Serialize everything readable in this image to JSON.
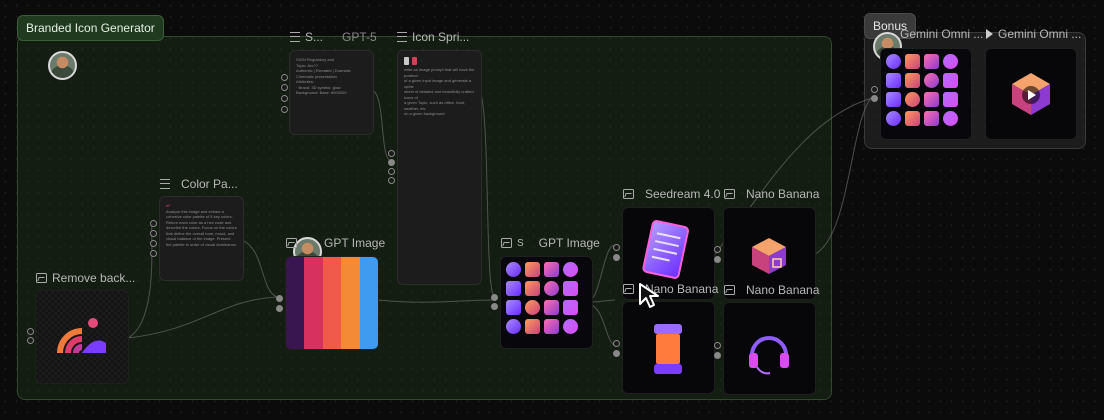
{
  "groups": {
    "main": {
      "title": "Branded Icon Generator"
    },
    "bonus": {
      "title": "Bonus"
    }
  },
  "nodes": {
    "system_prompt": {
      "title": "S...",
      "model": "GPT-5",
      "text": "SIGN Regulatory and\nTopic: Arc??\nAuthentic | Elevated | Dramatic Cinematic presentation\nAttributes:\n· Brand: 3D symbol: glow\nBackground: Base: #000000"
    },
    "icon_sprite": {
      "title": "Icon Spri...",
      "text": "write an image prompt that will have the position\nof a given input image and generate a sprite\nsheet of detailed and beautifully crafted icons of\na given Topic, such as office, food, weather, etc\non a given background"
    },
    "color_palette": {
      "title": "Color Pa...",
      "text_hl": "#F",
      "text": "Analyze this image and extract a cohesive color palette of 5 key colors. Return each color as a hex code and describe the colors. Focus on the colors that define the overall tone, mood, and visual balance of the image. Present the palette in order of visual dominance."
    },
    "remove_bg": {
      "title": "Remove back..."
    },
    "gpt_image_1": {
      "title": "GPT Image"
    },
    "gpt_image_2": {
      "title": "GPT Image",
      "prefix": "S"
    },
    "seedream": {
      "title": "Seedream 4.0"
    },
    "nano_banana_1": {
      "title": "Nano Banana"
    },
    "nano_banana_2": {
      "title": "Nano Banana"
    },
    "nano_banana_3": {
      "title": "Nano Banana"
    },
    "gemini_omni_1": {
      "title": "Gemini Omni ..."
    },
    "gemini_omni_2": {
      "title": "Gemini Omni ..."
    }
  },
  "palette": [
    "#3a1650",
    "#d7325f",
    "#ef5a4a",
    "#f58a36",
    "#3f9bf0"
  ],
  "icons": {
    "left_grid": [
      "file-icon",
      "cube-icon",
      "crystal-icon",
      "headphones-icon",
      "capsule-icon",
      "sword-icon",
      "ring-icon",
      "gear-icon",
      "eye-icon",
      "pinwheel-icon",
      "jar-icon",
      "potion-icon",
      "shield-icon",
      "flask-icon",
      "crown-icon",
      "gem-icon"
    ],
    "right_grid": [
      "file-icon",
      "cube-icon",
      "crystal-icon",
      "headphones-icon",
      "capsule-icon",
      "sword-icon",
      "ring-icon",
      "potion-icon",
      "eye-icon",
      "pinwheel-icon",
      "jar-icon",
      "flask-icon",
      "shield-icon",
      "gem-icon",
      "crown-icon",
      "orb-icon"
    ]
  },
  "colors": {
    "accent_purple": "#7a3cff",
    "accent_pink": "#d94cf0",
    "group_green": "#1c2e18"
  }
}
